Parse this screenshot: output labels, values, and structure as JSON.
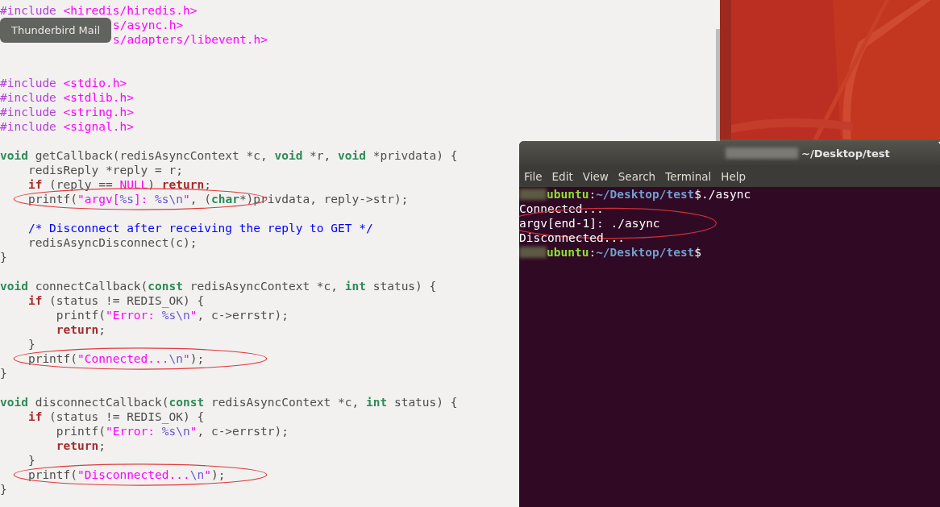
{
  "editor": {
    "tooltip": "Thunderbird Mail",
    "lines": [
      {
        "kind": "code",
        "covered": false,
        "circled": false,
        "segments": [
          {
            "kind": "pre",
            "text": "#include"
          },
          {
            "kind": "str",
            "text": " <hiredis/hiredis.h>"
          }
        ]
      },
      {
        "kind": "code",
        "covered": true,
        "circled": false,
        "segments": [
          {
            "kind": "str",
            "text": "s/async.h>"
          }
        ]
      },
      {
        "kind": "code",
        "covered": true,
        "circled": false,
        "segments": [
          {
            "kind": "str",
            "text": "s/adapters/libevent.h>"
          }
        ]
      },
      {
        "kind": "blank"
      },
      {
        "kind": "blank"
      },
      {
        "kind": "code",
        "covered": false,
        "circled": false,
        "segments": [
          {
            "kind": "pre",
            "text": "#include"
          },
          {
            "kind": "str",
            "text": " <stdio.h>"
          }
        ]
      },
      {
        "kind": "code",
        "covered": false,
        "circled": false,
        "segments": [
          {
            "kind": "pre",
            "text": "#include"
          },
          {
            "kind": "str",
            "text": " <stdlib.h>"
          }
        ]
      },
      {
        "kind": "code",
        "covered": false,
        "circled": false,
        "segments": [
          {
            "kind": "pre",
            "text": "#include"
          },
          {
            "kind": "str",
            "text": " <string.h>"
          }
        ]
      },
      {
        "kind": "code",
        "covered": false,
        "circled": false,
        "segments": [
          {
            "kind": "pre",
            "text": "#include"
          },
          {
            "kind": "str",
            "text": " <signal.h>"
          }
        ]
      },
      {
        "kind": "blank"
      },
      {
        "kind": "code",
        "covered": false,
        "circled": false,
        "segments": [
          {
            "kind": "kw",
            "text": "void"
          },
          {
            "kind": "plain",
            "text": " getCallback(redisAsyncContext *c, "
          },
          {
            "kind": "kw",
            "text": "void"
          },
          {
            "kind": "plain",
            "text": " *r, "
          },
          {
            "kind": "kw",
            "text": "void"
          },
          {
            "kind": "plain",
            "text": " *privdata) {"
          }
        ]
      },
      {
        "kind": "code",
        "covered": false,
        "circled": false,
        "segments": [
          {
            "kind": "plain",
            "text": "    redisReply *reply = r;"
          }
        ]
      },
      {
        "kind": "code",
        "covered": false,
        "circled": false,
        "segments": [
          {
            "kind": "flow",
            "text": "    if"
          },
          {
            "kind": "plain",
            "text": " (reply == "
          },
          {
            "kind": "str",
            "text": "NULL"
          },
          {
            "kind": "plain",
            "text": ") "
          },
          {
            "kind": "flow",
            "text": "return"
          },
          {
            "kind": "plain",
            "text": ";"
          }
        ]
      },
      {
        "kind": "code",
        "covered": false,
        "circled": true,
        "segments": [
          {
            "kind": "plain",
            "text": "    printf("
          },
          {
            "kind": "str",
            "text": "\"argv["
          },
          {
            "kind": "esc",
            "text": "%s"
          },
          {
            "kind": "str",
            "text": "]: "
          },
          {
            "kind": "esc",
            "text": "%s\\n"
          },
          {
            "kind": "str",
            "text": "\""
          },
          {
            "kind": "plain",
            "text": ", ("
          },
          {
            "kind": "kw",
            "text": "char"
          },
          {
            "kind": "plain",
            "text": "*)privdata, reply->str);"
          }
        ]
      },
      {
        "kind": "blank"
      },
      {
        "kind": "code",
        "covered": false,
        "circled": false,
        "segments": [
          {
            "kind": "comment",
            "text": "    /* Disconnect after receiving the reply to GET */"
          }
        ]
      },
      {
        "kind": "code",
        "covered": false,
        "circled": false,
        "segments": [
          {
            "kind": "plain",
            "text": "    redisAsyncDisconnect(c);"
          }
        ]
      },
      {
        "kind": "code",
        "covered": false,
        "circled": false,
        "segments": [
          {
            "kind": "plain",
            "text": "}"
          }
        ]
      },
      {
        "kind": "blank"
      },
      {
        "kind": "code",
        "covered": false,
        "circled": false,
        "segments": [
          {
            "kind": "kw",
            "text": "void"
          },
          {
            "kind": "plain",
            "text": " connectCallback("
          },
          {
            "kind": "kw",
            "text": "const"
          },
          {
            "kind": "plain",
            "text": " redisAsyncContext *c, "
          },
          {
            "kind": "kw",
            "text": "int"
          },
          {
            "kind": "plain",
            "text": " status) {"
          }
        ]
      },
      {
        "kind": "code",
        "covered": false,
        "circled": false,
        "segments": [
          {
            "kind": "flow",
            "text": "    if"
          },
          {
            "kind": "plain",
            "text": " (status != REDIS_OK) {"
          }
        ]
      },
      {
        "kind": "code",
        "covered": false,
        "circled": false,
        "segments": [
          {
            "kind": "plain",
            "text": "        printf("
          },
          {
            "kind": "str",
            "text": "\"Error: "
          },
          {
            "kind": "esc",
            "text": "%s\\n"
          },
          {
            "kind": "str",
            "text": "\""
          },
          {
            "kind": "plain",
            "text": ", c->errstr);"
          }
        ]
      },
      {
        "kind": "code",
        "covered": false,
        "circled": false,
        "segments": [
          {
            "kind": "flow",
            "text": "        return"
          },
          {
            "kind": "plain",
            "text": ";"
          }
        ]
      },
      {
        "kind": "code",
        "covered": false,
        "circled": false,
        "segments": [
          {
            "kind": "plain",
            "text": "    }"
          }
        ]
      },
      {
        "kind": "code",
        "covered": false,
        "circled": true,
        "segments": [
          {
            "kind": "plain",
            "text": "    printf("
          },
          {
            "kind": "str",
            "text": "\"Connected..."
          },
          {
            "kind": "esc",
            "text": "\\n"
          },
          {
            "kind": "str",
            "text": "\""
          },
          {
            "kind": "plain",
            "text": ");"
          }
        ]
      },
      {
        "kind": "code",
        "covered": false,
        "circled": false,
        "segments": [
          {
            "kind": "plain",
            "text": "}"
          }
        ]
      },
      {
        "kind": "blank"
      },
      {
        "kind": "code",
        "covered": false,
        "circled": false,
        "segments": [
          {
            "kind": "kw",
            "text": "void"
          },
          {
            "kind": "plain",
            "text": " disconnectCallback("
          },
          {
            "kind": "kw",
            "text": "const"
          },
          {
            "kind": "plain",
            "text": " redisAsyncContext *c, "
          },
          {
            "kind": "kw",
            "text": "int"
          },
          {
            "kind": "plain",
            "text": " status) {"
          }
        ]
      },
      {
        "kind": "code",
        "covered": false,
        "circled": false,
        "segments": [
          {
            "kind": "flow",
            "text": "    if"
          },
          {
            "kind": "plain",
            "text": " (status != REDIS_OK) {"
          }
        ]
      },
      {
        "kind": "code",
        "covered": false,
        "circled": false,
        "segments": [
          {
            "kind": "plain",
            "text": "        printf("
          },
          {
            "kind": "str",
            "text": "\"Error: "
          },
          {
            "kind": "esc",
            "text": "%s\\n"
          },
          {
            "kind": "str",
            "text": "\""
          },
          {
            "kind": "plain",
            "text": ", c->errstr);"
          }
        ]
      },
      {
        "kind": "code",
        "covered": false,
        "circled": false,
        "segments": [
          {
            "kind": "flow",
            "text": "        return"
          },
          {
            "kind": "plain",
            "text": ";"
          }
        ]
      },
      {
        "kind": "code",
        "covered": false,
        "circled": false,
        "segments": [
          {
            "kind": "plain",
            "text": "    }"
          }
        ]
      },
      {
        "kind": "code",
        "covered": false,
        "circled": true,
        "segments": [
          {
            "kind": "plain",
            "text": "    printf("
          },
          {
            "kind": "str",
            "text": "\"Disconnected..."
          },
          {
            "kind": "esc",
            "text": "\\n"
          },
          {
            "kind": "str",
            "text": "\""
          },
          {
            "kind": "plain",
            "text": ");"
          }
        ]
      },
      {
        "kind": "code",
        "covered": false,
        "circled": false,
        "segments": [
          {
            "kind": "plain",
            "text": "}"
          }
        ]
      }
    ]
  },
  "terminal": {
    "title": "~/Desktop/test",
    "menu": [
      "File",
      "Edit",
      "View",
      "Search",
      "Terminal",
      "Help"
    ],
    "lines": [
      {
        "kind": "prompt",
        "host": "ubuntu",
        "separator": ":",
        "path": "~/Desktop/test",
        "symbol": "$",
        "command": "./async"
      },
      {
        "kind": "output",
        "text": "Connected...",
        "circled": false
      },
      {
        "kind": "output",
        "text": "argv[end-1]: ./async",
        "circled": true
      },
      {
        "kind": "output",
        "text": "Disconnected...",
        "circled": false
      },
      {
        "kind": "prompt",
        "host": "ubuntu",
        "separator": ":",
        "path": "~/Desktop/test",
        "symbol": "$"
      }
    ]
  }
}
